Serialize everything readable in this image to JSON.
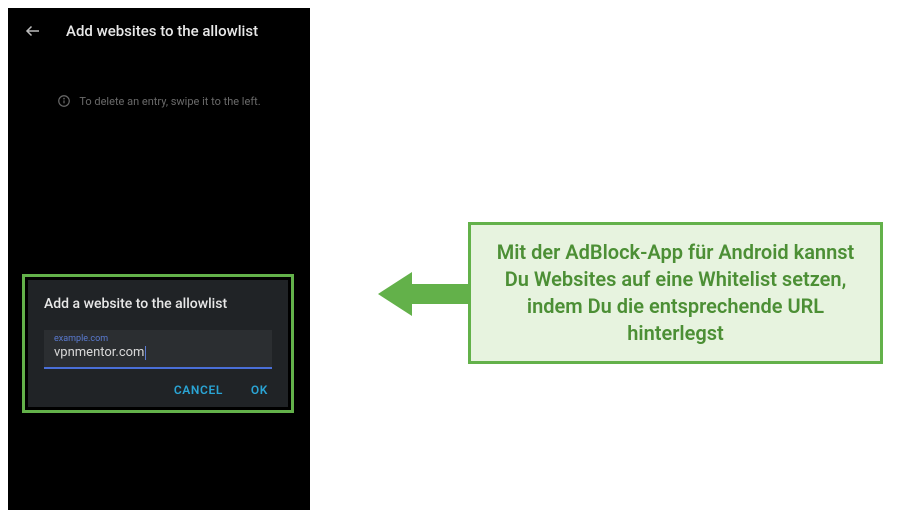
{
  "app_bar": {
    "title": "Add websites to the allowlist"
  },
  "hint": {
    "text": "To delete an entry, swipe it to the left."
  },
  "dialog": {
    "title": "Add a website to the allowlist",
    "input_placeholder": "example.com",
    "input_value": "vpnmentor.com",
    "cancel_label": "CANCEL",
    "ok_label": "OK"
  },
  "callout": {
    "text": "Mit der AdBlock-App für Android kannst Du Websites auf eine Whitelist setzen, indem Du die entsprechende URL hinterlegst"
  },
  "colors": {
    "accent_green": "#63b14a",
    "accent_blue": "#2aa4d4",
    "input_underline": "#4a6fd8"
  }
}
